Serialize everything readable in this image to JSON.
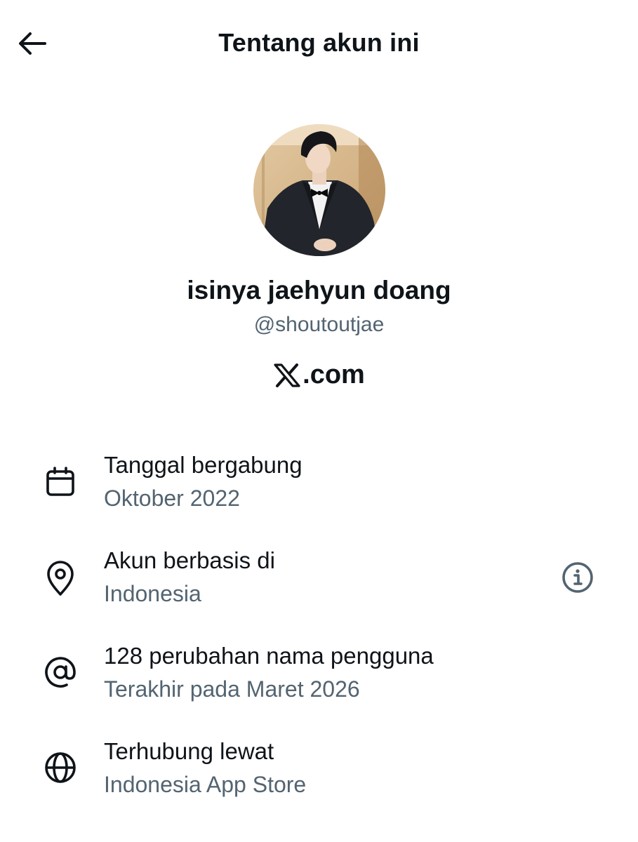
{
  "header": {
    "back_icon": "arrow-left-icon",
    "title": "Tentang akun ini"
  },
  "profile": {
    "display_name": "isinya jaehyun doang",
    "handle": "@shoutoutjae",
    "platform_label": ".com",
    "platform_logo_icon": "x-logo-icon"
  },
  "details": [
    {
      "icon": "calendar-icon",
      "title": "Tanggal bergabung",
      "value": "Oktober 2022"
    },
    {
      "icon": "location-pin-icon",
      "title": "Akun berbasis di",
      "value": "Indonesia",
      "info_icon": "info-icon"
    },
    {
      "icon": "at-sign-icon",
      "title": "128 perubahan nama pengguna",
      "value": "Terakhir pada Maret 2026"
    },
    {
      "icon": "globe-icon",
      "title": "Terhubung lewat",
      "value": "Indonesia App Store"
    }
  ],
  "colors": {
    "text_primary": "#0f1419",
    "text_secondary": "#536471",
    "background": "#ffffff"
  }
}
